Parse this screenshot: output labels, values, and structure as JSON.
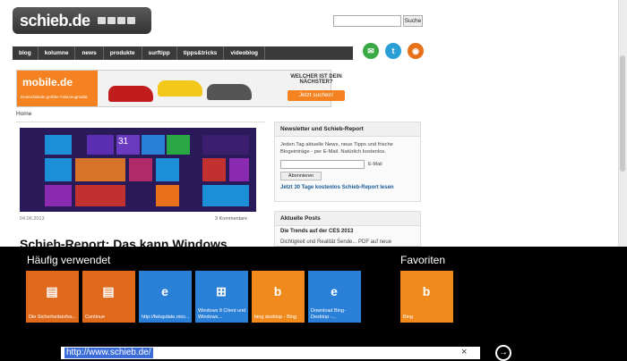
{
  "site": {
    "logo": "schieb.de",
    "search_placeholder": "",
    "search_button": "Suche",
    "nav": [
      "blog",
      "kolumne",
      "news",
      "produkte",
      "surftipp",
      "tipps&tricks",
      "videoblog"
    ],
    "social_icons": [
      "email-icon",
      "twitter-icon",
      "rss-icon"
    ]
  },
  "banner": {
    "logo": "mobile.de",
    "logo_sub": "Deutschlands größter Fahrzeugmarkt",
    "question": "WELCHER IST DEIN NÄCHSTER?",
    "button": "Jetzt suchen!"
  },
  "breadcrumb": "Home",
  "article": {
    "date": "04.06.2013",
    "comments": "3 Kommentare",
    "title": "Schieb-Report: Das kann Windows",
    "hero_number": "31"
  },
  "newsletter": {
    "heading": "Newsletter und Schieb-Report",
    "text": "Jeden Tag aktuelle News, neue Tipps und frische Blogeinträge - per E-Mail. Natürlich kostenlos.",
    "email_label": "E-Mail",
    "button": "Abonnieren",
    "link": "Jetzt 30 Tage kostenlos Schieb-Report lesen"
  },
  "posts": {
    "heading": "Aktuelle Posts",
    "first": "Die Trends auf der CES 2013",
    "second": "Dichtigkeit und Realität Sende... PDF auf neue"
  },
  "charm": {
    "frequent_heading": "Häufig verwendet",
    "favorites_heading": "Favoriten",
    "frequent": [
      {
        "label": "Die Sicherheitsinfos...",
        "color": "#e06a1b",
        "icon": "page-icon"
      },
      {
        "label": "Continue",
        "color": "#e06a1b",
        "icon": "page-icon"
      },
      {
        "label": "http://fwlupdate.micr...",
        "color": "#2a7fd6",
        "icon": "ie-icon"
      },
      {
        "label": "Windows 8 Client und Windows...",
        "color": "#2a7fd6",
        "icon": "windows-icon"
      },
      {
        "label": "bing desktop - Bing",
        "color": "#f08a1c",
        "icon": "bing-icon"
      },
      {
        "label": "Download Bing-Desktop -...",
        "color": "#2a7fd6",
        "icon": "ie-icon"
      }
    ],
    "favorites": [
      {
        "label": "Bing",
        "color": "#f08a1c",
        "icon": "bing-icon"
      }
    ],
    "address_value": "http://www.schieb.de/",
    "clear_icon": "×",
    "go_icon": "→"
  }
}
